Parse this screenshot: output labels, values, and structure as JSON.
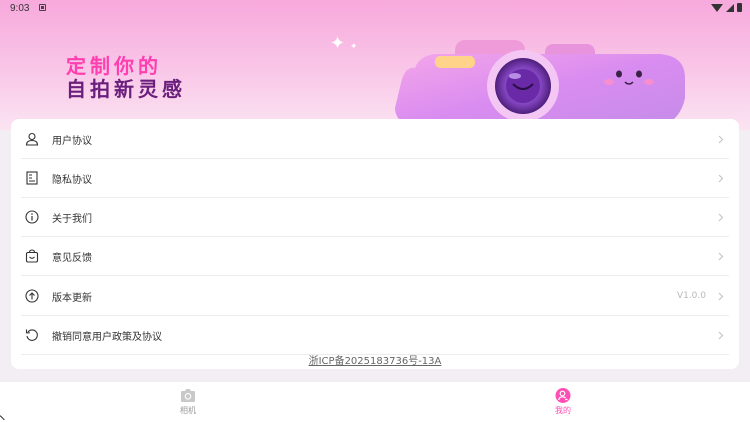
{
  "status_bar": {
    "time": "9:03"
  },
  "hero": {
    "slogan_line1": "定制你的",
    "slogan_line2": "自拍新灵感"
  },
  "menu": [
    {
      "label": "用户协议",
      "icon": "user-icon",
      "value": ""
    },
    {
      "label": "隐私协议",
      "icon": "document-icon",
      "value": ""
    },
    {
      "label": "关于我们",
      "icon": "info-icon",
      "value": ""
    },
    {
      "label": "意见反馈",
      "icon": "feedback-bag-icon",
      "value": ""
    },
    {
      "label": "版本更新",
      "icon": "upload-arrow-icon",
      "value": "V1.0.0"
    },
    {
      "label": "撤销同意用户政策及协议",
      "icon": "undo-icon",
      "value": ""
    }
  ],
  "footer": {
    "icp": "浙ICP备2025183736号-13A"
  },
  "tabbar": {
    "tabs": [
      {
        "label": "相机",
        "icon": "camera-icon",
        "active": false
      },
      {
        "label": "我的",
        "icon": "profile-icon",
        "active": true
      }
    ]
  },
  "colors": {
    "accent": "#ff4fb4",
    "slogan_pink": "#ff3fb0",
    "slogan_purple": "#6a1f7d"
  }
}
